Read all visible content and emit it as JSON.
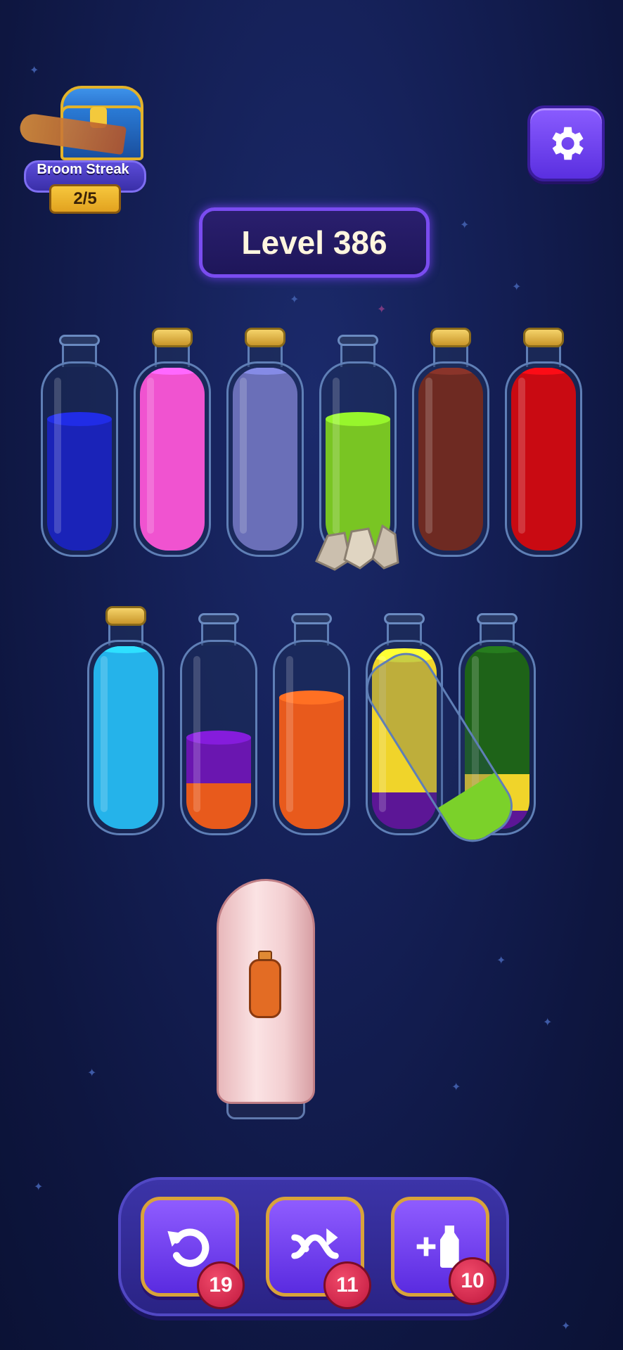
{
  "streak": {
    "label": "Broom Streak",
    "count": "2/5"
  },
  "level": {
    "text": "Level 386"
  },
  "icons": {
    "settings": "gear-icon",
    "undo": "undo-icon",
    "shuffle": "shuffle-icon",
    "add_bottle": "add-bottle-icon"
  },
  "bottles": [
    {
      "name": "bottle-1",
      "corked": false,
      "layers": [
        "#1a23b8"
      ],
      "fill": [
        0.72
      ]
    },
    {
      "name": "bottle-2",
      "corked": true,
      "layers": [
        "#f053d0"
      ],
      "fill": [
        1.0
      ]
    },
    {
      "name": "bottle-3",
      "corked": true,
      "layers": [
        "#6a6fb8"
      ],
      "fill": [
        1.0
      ]
    },
    {
      "name": "bottle-4",
      "corked": false,
      "layers": [
        "#79c523"
      ],
      "fill": [
        0.72
      ]
    },
    {
      "name": "bottle-5",
      "corked": true,
      "layers": [
        "#6e2a22"
      ],
      "fill": [
        1.0
      ]
    },
    {
      "name": "bottle-6",
      "corked": true,
      "layers": [
        "#c90a12"
      ],
      "fill": [
        1.0
      ]
    },
    {
      "name": "bottle-7",
      "corked": true,
      "layers": [
        "#25b3ea"
      ],
      "fill": [
        1.0
      ]
    },
    {
      "name": "bottle-8",
      "corked": false,
      "layers": [
        "#e85a1c",
        "#6a16b0"
      ],
      "fill": [
        0.25,
        0.25
      ]
    },
    {
      "name": "bottle-9",
      "corked": false,
      "layers": [
        "#e85a1c"
      ],
      "fill": [
        0.72
      ]
    },
    {
      "name": "bottle-10",
      "corked": false,
      "layers": [
        "#5c1696",
        "#f0d42a"
      ],
      "fill": [
        0.2,
        0.75
      ]
    },
    {
      "name": "bottle-11",
      "corked": false,
      "layers": [
        "#5c1696",
        "#f0d42a",
        "#1e6318"
      ],
      "fill": [
        0.1,
        0.2,
        0.7
      ]
    }
  ],
  "tools": {
    "undo_count": "19",
    "shuffle_count": "11",
    "add_count": "10"
  },
  "colors": {
    "accent": "#7a4cf0",
    "button": "#6a3df0",
    "badge": "#c0183e"
  }
}
